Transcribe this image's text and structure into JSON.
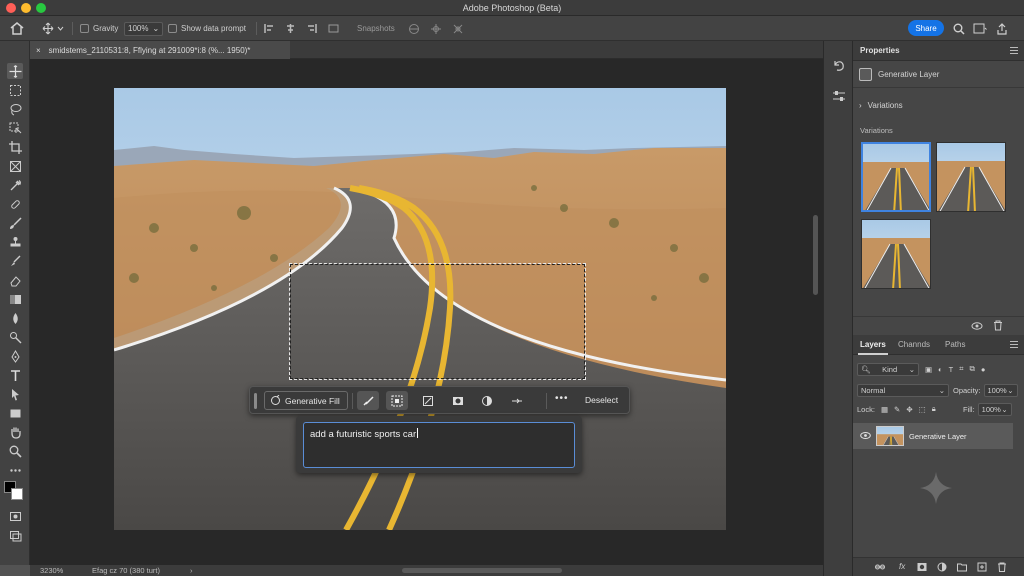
{
  "app": {
    "window_title": "Adobe Photoshop (Beta)",
    "share_label": "Share"
  },
  "options_bar": {
    "gravity_label": "Gravity",
    "zoom_value": "100%",
    "show_prompt_label": "Show data prompt",
    "snapshots_label": "Snapshots"
  },
  "document": {
    "tab_title": "smidstems_2110531:8, Fflying at 291009*i:8 (%... 1950)*"
  },
  "context_bar": {
    "generative_fill_label": "Generative Fill",
    "more_label": "•••",
    "deselect_label": "Deselect"
  },
  "prompt": {
    "value": "add a futuristic sports car"
  },
  "status_bar": {
    "zoom": "3230%",
    "doc_info": "Efag cz 70 (380 turt)"
  },
  "properties": {
    "title": "Properties",
    "layer_type": "Generative Layer",
    "variations_header": "Variations",
    "variations_label": "Variations",
    "variation_count": 3,
    "selected_variation": 1
  },
  "layers": {
    "tabs": [
      "Layers",
      "Channds",
      "Paths"
    ],
    "active_tab": "Layers",
    "kind_filter": "Kind",
    "blend_mode": "Normal",
    "opacity_label": "Opacity:",
    "opacity_value": "100%",
    "lock_label": "Lock:",
    "fill_label": "Fill:",
    "fill_value": "100%",
    "items": [
      {
        "name": "Generative Layer",
        "visible": true
      }
    ]
  },
  "colors": {
    "accent_blue": "#1473e6",
    "selection_blue": "#3f83e0",
    "panel_bg": "#464646",
    "canvas_bg": "#282828"
  }
}
